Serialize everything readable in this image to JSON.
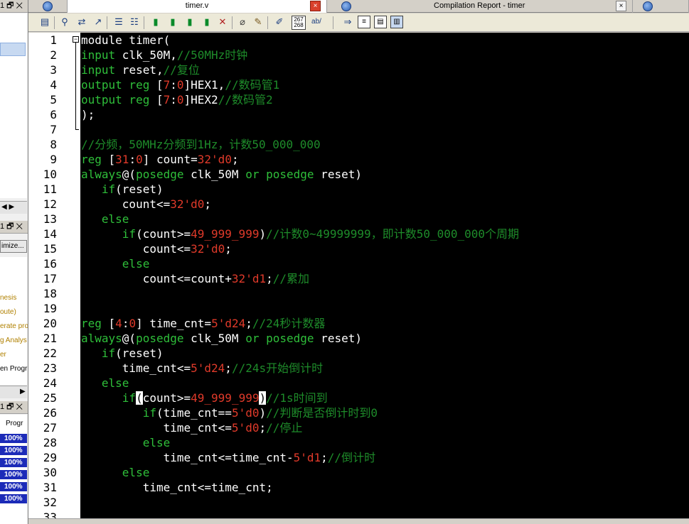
{
  "left_panel": {
    "header_buttons": "1 🗗 ✕",
    "header_buttons_2": "1 🗗 ✕",
    "header_buttons_3": "1 🗗 ✕",
    "optimize_label": "imize...",
    "tasks": [
      "nesis",
      "oute)",
      "erate pro",
      "g Analys",
      "er",
      "en Progr"
    ],
    "progress_header": "Progr",
    "progress_values": [
      "100%",
      "100%",
      "100%",
      "100%",
      "100%",
      "100%"
    ]
  },
  "tabs": {
    "file_tab": "timer.v",
    "report_tab": "Compilation Report - timer",
    "close_glyph": "×"
  },
  "toolbar": {
    "icons": [
      "file-icon",
      "find-icon",
      "find-replace-icon",
      "goto-icon",
      "indent-icon",
      "unindent-icon",
      "bookmark-toggle-icon",
      "bookmark-next-icon",
      "bookmark-prev-icon",
      "bookmark-clear-icon",
      "attach-icon",
      "scroll-icon",
      "pen-icon",
      "line-numbers-icon",
      "abc-icon",
      "insert-template-icon",
      "template-icon",
      "block-comment-icon",
      "uncomment-icon"
    ],
    "line_num_button": "267 268",
    "ab_button": "ab/"
  },
  "editor": {
    "line_numbers": [
      "1",
      "2",
      "3",
      "4",
      "5",
      "6",
      "7",
      "8",
      "9",
      "10",
      "11",
      "12",
      "13",
      "14",
      "15",
      "16",
      "17",
      "18",
      "19",
      "20",
      "21",
      "22",
      "23",
      "24",
      "25",
      "26",
      "27",
      "28",
      "29",
      "30",
      "31",
      "32",
      "33"
    ],
    "lines": [
      [
        {
          "t": "module timer(",
          "c": "wt"
        }
      ],
      [
        {
          "t": "input",
          "c": "kw"
        },
        {
          "t": " clk_50M,",
          "c": "wt"
        },
        {
          "t": "//50MHz时钟",
          "c": "cm"
        }
      ],
      [
        {
          "t": "input",
          "c": "kw"
        },
        {
          "t": " reset,",
          "c": "wt"
        },
        {
          "t": "//复位",
          "c": "cm"
        }
      ],
      [
        {
          "t": "output reg",
          "c": "kw"
        },
        {
          "t": " [",
          "c": "wt"
        },
        {
          "t": "7",
          "c": "nm"
        },
        {
          "t": ":",
          "c": "wt"
        },
        {
          "t": "0",
          "c": "nm"
        },
        {
          "t": "]HEX1,",
          "c": "wt"
        },
        {
          "t": "//数码管1",
          "c": "cm"
        }
      ],
      [
        {
          "t": "output reg",
          "c": "kw"
        },
        {
          "t": " [",
          "c": "wt"
        },
        {
          "t": "7",
          "c": "nm"
        },
        {
          "t": ":",
          "c": "wt"
        },
        {
          "t": "0",
          "c": "nm"
        },
        {
          "t": "]HEX2",
          "c": "wt"
        },
        {
          "t": "//数码管2",
          "c": "cm"
        }
      ],
      [
        {
          "t": ");",
          "c": "wt"
        }
      ],
      [],
      [
        {
          "t": "//分频，50MHz分频到1Hz，计数50_000_000",
          "c": "cm"
        }
      ],
      [
        {
          "t": "reg",
          "c": "kw"
        },
        {
          "t": " [",
          "c": "wt"
        },
        {
          "t": "31",
          "c": "nm"
        },
        {
          "t": ":",
          "c": "wt"
        },
        {
          "t": "0",
          "c": "nm"
        },
        {
          "t": "] count=",
          "c": "wt"
        },
        {
          "t": "32'd0",
          "c": "nm"
        },
        {
          "t": ";",
          "c": "wt"
        }
      ],
      [
        {
          "t": "always",
          "c": "kw"
        },
        {
          "t": "@(",
          "c": "wt"
        },
        {
          "t": "posedge",
          "c": "kw"
        },
        {
          "t": " clk_50M ",
          "c": "wt"
        },
        {
          "t": "or",
          "c": "kw"
        },
        {
          "t": " ",
          "c": "wt"
        },
        {
          "t": "posedge",
          "c": "kw"
        },
        {
          "t": " reset)",
          "c": "wt"
        }
      ],
      [
        {
          "t": "   ",
          "c": "wt"
        },
        {
          "t": "if",
          "c": "kw"
        },
        {
          "t": "(reset)",
          "c": "wt"
        }
      ],
      [
        {
          "t": "      count<=",
          "c": "wt"
        },
        {
          "t": "32'd0",
          "c": "nm"
        },
        {
          "t": ";",
          "c": "wt"
        }
      ],
      [
        {
          "t": "   ",
          "c": "wt"
        },
        {
          "t": "else",
          "c": "kw"
        }
      ],
      [
        {
          "t": "      ",
          "c": "wt"
        },
        {
          "t": "if",
          "c": "kw"
        },
        {
          "t": "(count>=",
          "c": "wt"
        },
        {
          "t": "49_999_999",
          "c": "nm"
        },
        {
          "t": ")",
          "c": "wt"
        },
        {
          "t": "//计数0~49999999，即计数50_000_000个周期",
          "c": "cm"
        }
      ],
      [
        {
          "t": "         count<=",
          "c": "wt"
        },
        {
          "t": "32'd0",
          "c": "nm"
        },
        {
          "t": ";",
          "c": "wt"
        }
      ],
      [
        {
          "t": "      ",
          "c": "wt"
        },
        {
          "t": "else",
          "c": "kw"
        }
      ],
      [
        {
          "t": "         count<=count+",
          "c": "wt"
        },
        {
          "t": "32'd1",
          "c": "nm"
        },
        {
          "t": ";",
          "c": "wt"
        },
        {
          "t": "//累加",
          "c": "cm"
        }
      ],
      [],
      [],
      [
        {
          "t": "reg",
          "c": "kw"
        },
        {
          "t": " [",
          "c": "wt"
        },
        {
          "t": "4",
          "c": "nm"
        },
        {
          "t": ":",
          "c": "wt"
        },
        {
          "t": "0",
          "c": "nm"
        },
        {
          "t": "] time_cnt=",
          "c": "wt"
        },
        {
          "t": "5'd24",
          "c": "nm"
        },
        {
          "t": ";",
          "c": "wt"
        },
        {
          "t": "//24秒计数器",
          "c": "cm"
        }
      ],
      [
        {
          "t": "always",
          "c": "kw"
        },
        {
          "t": "@(",
          "c": "wt"
        },
        {
          "t": "posedge",
          "c": "kw"
        },
        {
          "t": " clk_50M ",
          "c": "wt"
        },
        {
          "t": "or",
          "c": "kw"
        },
        {
          "t": " ",
          "c": "wt"
        },
        {
          "t": "posedge",
          "c": "kw"
        },
        {
          "t": " reset)",
          "c": "wt"
        }
      ],
      [
        {
          "t": "   ",
          "c": "wt"
        },
        {
          "t": "if",
          "c": "kw"
        },
        {
          "t": "(reset)",
          "c": "wt"
        }
      ],
      [
        {
          "t": "      time_cnt<=",
          "c": "wt"
        },
        {
          "t": "5'd24",
          "c": "nm"
        },
        {
          "t": ";",
          "c": "wt"
        },
        {
          "t": "//24s开始倒计时",
          "c": "cm"
        }
      ],
      [
        {
          "t": "   ",
          "c": "wt"
        },
        {
          "t": "else",
          "c": "kw"
        }
      ],
      [
        {
          "t": "      ",
          "c": "wt"
        },
        {
          "t": "if",
          "c": "kw"
        },
        {
          "t": "(",
          "c": "cursor"
        },
        {
          "t": "count>=",
          "c": "wt"
        },
        {
          "t": "49_999_999",
          "c": "nm"
        },
        {
          "t": ")",
          "c": "cursor"
        },
        {
          "t": "//1s时间到",
          "c": "cm"
        }
      ],
      [
        {
          "t": "         ",
          "c": "wt"
        },
        {
          "t": "if",
          "c": "kw"
        },
        {
          "t": "(time_cnt==",
          "c": "wt"
        },
        {
          "t": "5'd0",
          "c": "nm"
        },
        {
          "t": ")",
          "c": "wt"
        },
        {
          "t": "//判断是否倒计时到0",
          "c": "cm"
        }
      ],
      [
        {
          "t": "            time_cnt<=",
          "c": "wt"
        },
        {
          "t": "5'd0",
          "c": "nm"
        },
        {
          "t": ";",
          "c": "wt"
        },
        {
          "t": "//停止",
          "c": "cm"
        }
      ],
      [
        {
          "t": "         ",
          "c": "wt"
        },
        {
          "t": "else",
          "c": "kw"
        }
      ],
      [
        {
          "t": "            time_cnt<=time_cnt-",
          "c": "wt"
        },
        {
          "t": "5'd1",
          "c": "nm"
        },
        {
          "t": ";",
          "c": "wt"
        },
        {
          "t": "//倒计时",
          "c": "cm"
        }
      ],
      [
        {
          "t": "      ",
          "c": "wt"
        },
        {
          "t": "else",
          "c": "kw"
        }
      ],
      [
        {
          "t": "         time_cnt<=time_cnt;",
          "c": "wt"
        }
      ],
      [],
      []
    ],
    "colors": {
      "background": "#000000",
      "keyword": "#2fbf3a",
      "comment": "#1e8c2a",
      "number": "#e03a2a",
      "text": "#ffffff"
    }
  }
}
